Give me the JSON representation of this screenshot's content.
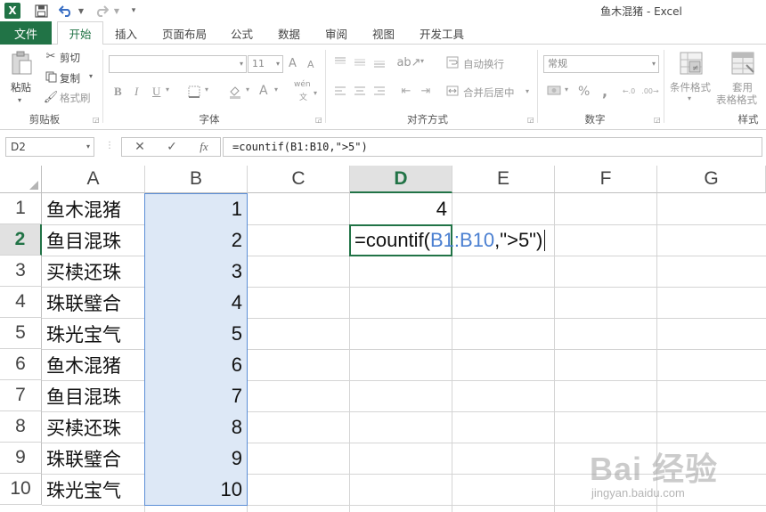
{
  "window": {
    "title": "鱼木混猪 - Excel"
  },
  "quick_access": {
    "app_icon": "excel-logo",
    "save": "save-icon",
    "undo": "undo-icon",
    "redo": "redo-icon",
    "customize": "customize-icon"
  },
  "tabs": {
    "file": "文件",
    "items": [
      "开始",
      "插入",
      "页面布局",
      "公式",
      "数据",
      "审阅",
      "视图",
      "开发工具"
    ],
    "active": "开始"
  },
  "ribbon": {
    "clipboard": {
      "paste": "粘贴",
      "cut": "剪切",
      "copy": "复制",
      "format_painter": "格式刷",
      "label": "剪贴板"
    },
    "font": {
      "size": "11",
      "bold": "B",
      "italic": "I",
      "underline": "U",
      "font_color_letter": "A",
      "grow": "A",
      "shrink": "A",
      "wen": "wén",
      "wen_sub": "文",
      "label": "字体"
    },
    "alignment": {
      "wrap": "自动换行",
      "merge": "合并后居中",
      "label": "对齐方式"
    },
    "number": {
      "format": "常规",
      "percent": "%",
      "comma": ",",
      "label": "数字"
    },
    "styles": {
      "conditional": "条件格式",
      "table_line1": "套用",
      "table_line2": "表格格式",
      "label": "样式"
    }
  },
  "formula_bar": {
    "name_box": "D2",
    "cancel": "✕",
    "enter": "✓",
    "fx": "fx",
    "formula": "=countif(B1:B10,\">5\")"
  },
  "grid": {
    "columns": [
      "A",
      "B",
      "C",
      "D",
      "E",
      "F",
      "G"
    ],
    "active_column": "D",
    "active_row": "2",
    "rows": [
      {
        "num": "1",
        "a": "鱼木混猪",
        "b": "1"
      },
      {
        "num": "2",
        "a": "鱼目混珠",
        "b": "2"
      },
      {
        "num": "3",
        "a": "买椟还珠",
        "b": "3"
      },
      {
        "num": "4",
        "a": "珠联璧合",
        "b": "4"
      },
      {
        "num": "5",
        "a": "珠光宝气",
        "b": "5"
      },
      {
        "num": "6",
        "a": "鱼木混猪",
        "b": "6"
      },
      {
        "num": "7",
        "a": "鱼目混珠",
        "b": "7"
      },
      {
        "num": "8",
        "a": "买椟还珠",
        "b": "8"
      },
      {
        "num": "9",
        "a": "珠联璧合",
        "b": "9"
      },
      {
        "num": "10",
        "a": "珠光宝气",
        "b": "10"
      }
    ],
    "d1": "4",
    "editor": {
      "prefix": "=countif(",
      "ref": "B1:B10",
      "suffix": ",\">5\")"
    }
  },
  "watermark": {
    "logo": "Bai 经验",
    "url": "jingyan.baidu.com"
  }
}
